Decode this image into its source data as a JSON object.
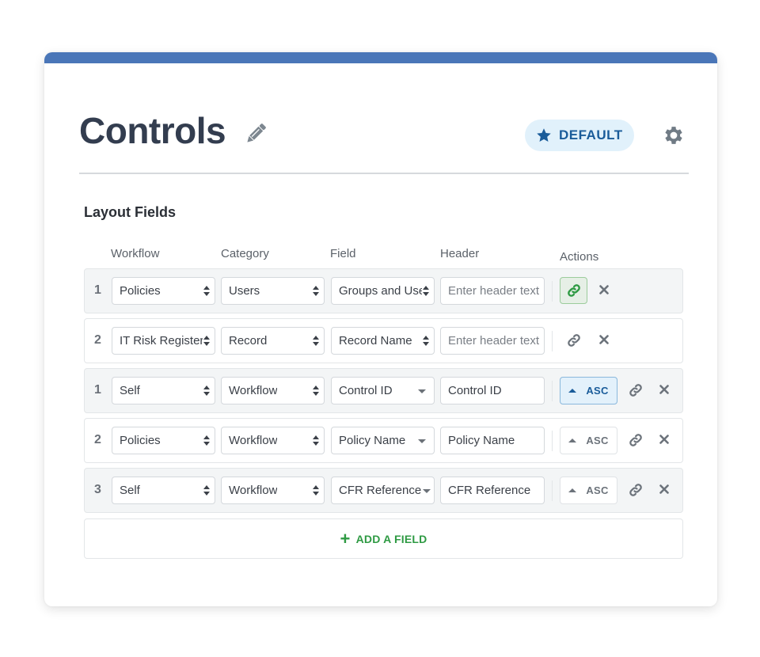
{
  "page": {
    "title": "Controls",
    "default_badge": "DEFAULT",
    "accent_color": "#4a76b8"
  },
  "section": {
    "title": "Layout Fields",
    "columns": [
      "Workflow",
      "Category",
      "Field",
      "Header",
      "Actions"
    ]
  },
  "rows": [
    {
      "num": "1",
      "workflow": "Policies",
      "category": "Users",
      "field": "Groups and Users",
      "field_control": "stepper",
      "header_value": "",
      "header_placeholder": "Enter header text",
      "sort": null,
      "link_active": true
    },
    {
      "num": "2",
      "workflow": "IT Risk Register",
      "category": "Record",
      "field": "Record Name",
      "field_control": "stepper",
      "header_value": "",
      "header_placeholder": "Enter header text",
      "sort": null,
      "link_active": false
    },
    {
      "num": "1",
      "workflow": "Self",
      "category": "Workflow",
      "field": "Control ID",
      "field_control": "dropdown",
      "header_value": "Control ID",
      "header_placeholder": "",
      "sort": "ASC",
      "sort_active": true
    },
    {
      "num": "2",
      "workflow": "Policies",
      "category": "Workflow",
      "field": "Policy Name",
      "field_control": "dropdown",
      "header_value": "Policy Name",
      "header_placeholder": "",
      "sort": "ASC",
      "sort_active": false
    },
    {
      "num": "3",
      "workflow": "Self",
      "category": "Workflow",
      "field": "CFR Reference",
      "field_control": "dropdown",
      "header_value": "CFR Reference",
      "header_placeholder": "",
      "sort": "ASC",
      "sort_active": false
    }
  ],
  "add_field_label": "ADD A FIELD",
  "icons": {
    "edit": "pencil-icon",
    "default": "star-icon",
    "settings": "gear-icon",
    "link": "link-icon",
    "remove": "close-icon",
    "sort": "caret-up-icon",
    "add": "plus-icon"
  }
}
